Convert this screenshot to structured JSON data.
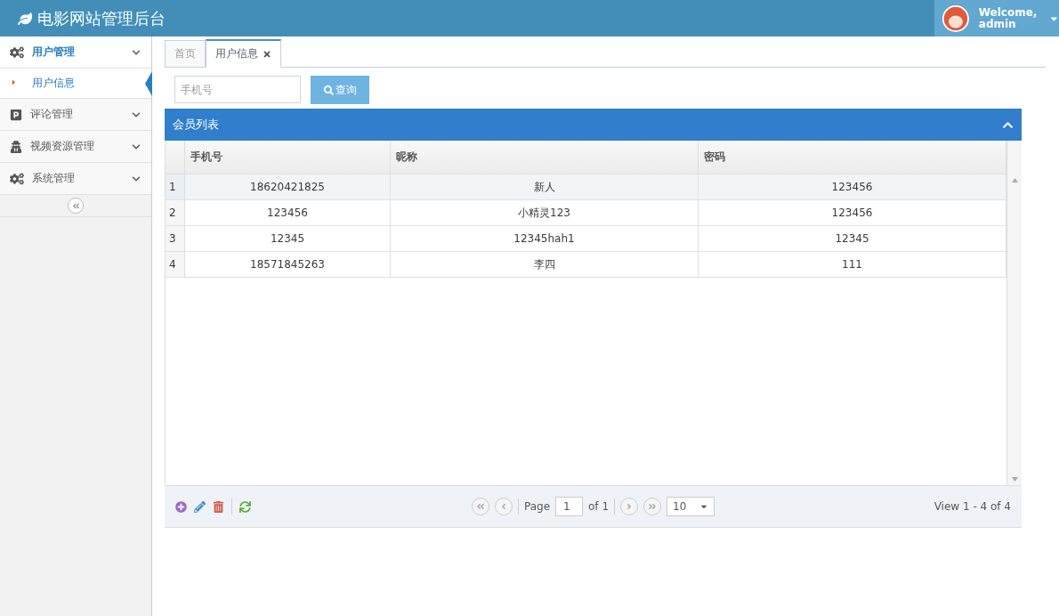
{
  "header": {
    "title": "电影网站管理后台",
    "user": {
      "greeting": "Welcome,",
      "name": "admin"
    }
  },
  "sidebar": {
    "menus": [
      {
        "label": "用户管理",
        "kind": "gears",
        "expanded": true,
        "children": [
          {
            "label": "用户信息",
            "selected": true
          }
        ]
      },
      {
        "label": "评论管理",
        "kind": "parking",
        "expanded": false
      },
      {
        "label": "视频资源管理",
        "kind": "spy",
        "expanded": false
      },
      {
        "label": "系统管理",
        "kind": "gears",
        "expanded": false
      }
    ]
  },
  "tabs": [
    {
      "label": "首页",
      "selected": false,
      "closable": false
    },
    {
      "label": "用户信息",
      "selected": true,
      "closable": true
    }
  ],
  "search": {
    "placeholder": "手机号",
    "button": "查询"
  },
  "grid": {
    "title": "会员列表",
    "columns": [
      "手机号",
      "昵称",
      "密码"
    ],
    "rows": [
      {
        "num": "1",
        "cells": [
          "18620421825",
          "新人",
          "123456"
        ],
        "selected": true
      },
      {
        "num": "2",
        "cells": [
          "123456",
          "小精灵123",
          "123456"
        ],
        "selected": false
      },
      {
        "num": "3",
        "cells": [
          "12345",
          "12345hah1",
          "12345"
        ],
        "selected": false
      },
      {
        "num": "4",
        "cells": [
          "18571845263",
          "李四",
          "111"
        ],
        "selected": false
      }
    ]
  },
  "pager": {
    "page_label": "Page",
    "page": "1",
    "of": "of 1",
    "page_size": "10",
    "view": "View 1 - 4 of 4"
  }
}
